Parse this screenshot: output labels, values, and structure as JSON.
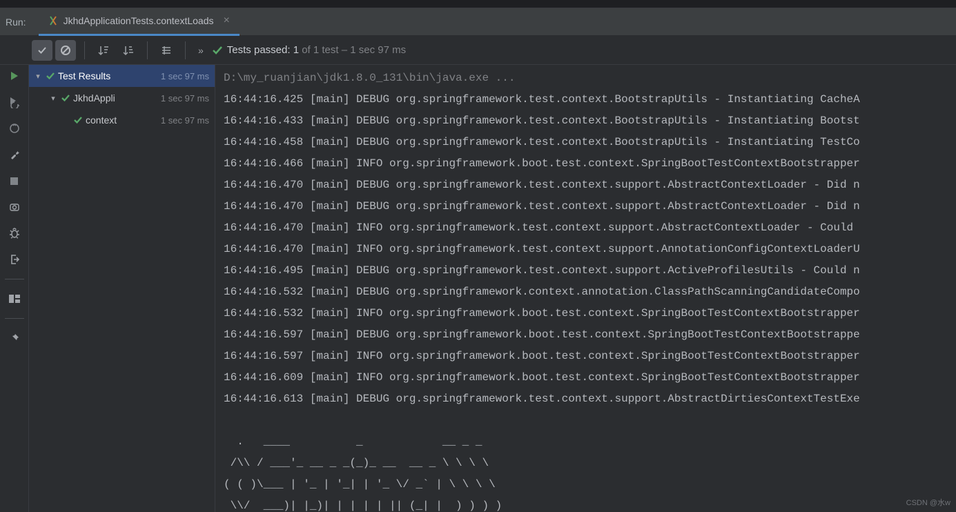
{
  "header": {
    "run_label": "Run:"
  },
  "tab": {
    "title": "JkhdApplicationTests.contextLoads",
    "close_glyph": "×"
  },
  "toolbar": {
    "status_prefix": "Tests passed: ",
    "passed_count": "1",
    "status_suffix": " of 1 test – 1 sec 97 ms"
  },
  "tree": {
    "root": {
      "label": "Test Results",
      "time": "1 sec 97 ms"
    },
    "node1": {
      "label": "JkhdAppli",
      "time": "1 sec 97 ms"
    },
    "node2": {
      "label": "context",
      "time": "1 sec 97 ms"
    }
  },
  "console": {
    "cmd": "D:\\my_ruanjian\\jdk1.8.0_131\\bin\\java.exe ...",
    "lines": [
      "16:44:16.425 [main] DEBUG org.springframework.test.context.BootstrapUtils - Instantiating CacheA",
      "16:44:16.433 [main] DEBUG org.springframework.test.context.BootstrapUtils - Instantiating Bootst",
      "16:44:16.458 [main] DEBUG org.springframework.test.context.BootstrapUtils - Instantiating TestCo",
      "16:44:16.466 [main] INFO org.springframework.boot.test.context.SpringBootTestContextBootstrapper",
      "16:44:16.470 [main] DEBUG org.springframework.test.context.support.AbstractContextLoader - Did n",
      "16:44:16.470 [main] DEBUG org.springframework.test.context.support.AbstractContextLoader - Did n",
      "16:44:16.470 [main] INFO org.springframework.test.context.support.AbstractContextLoader - Could ",
      "16:44:16.470 [main] INFO org.springframework.test.context.support.AnnotationConfigContextLoaderU",
      "16:44:16.495 [main] DEBUG org.springframework.test.context.support.ActiveProfilesUtils - Could n",
      "16:44:16.532 [main] DEBUG org.springframework.context.annotation.ClassPathScanningCandidateCompo",
      "16:44:16.532 [main] INFO org.springframework.boot.test.context.SpringBootTestContextBootstrapper",
      "16:44:16.597 [main] DEBUG org.springframework.boot.test.context.SpringBootTestContextBootstrappe",
      "16:44:16.597 [main] INFO org.springframework.boot.test.context.SpringBootTestContextBootstrapper",
      "16:44:16.609 [main] INFO org.springframework.boot.test.context.SpringBootTestContextBootstrapper",
      "16:44:16.613 [main] DEBUG org.springframework.test.context.support.AbstractDirtiesContextTestExe"
    ],
    "ascii": [
      "  .   ____          _            __ _ _",
      " /\\\\ / ___'_ __ _ _(_)_ __  __ _ \\ \\ \\ \\",
      "( ( )\\___ | '_ | '_| | '_ \\/ _` | \\ \\ \\ \\",
      " \\\\/  ___)| |_)| | | | | || (_| |  ) ) ) )"
    ]
  },
  "watermark": "CSDN @水w"
}
